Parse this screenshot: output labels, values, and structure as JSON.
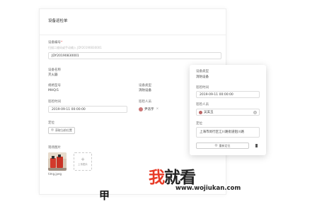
{
  "main": {
    "title": "设备巡检单",
    "device_no_label": "设备编号",
    "device_no_required": "*",
    "device_no_hint": "扫描二维码或手动输入 JDY20190830001",
    "device_no_value": "JDY20190830001",
    "device_name_label": "设备名称",
    "device_name_value": "灭火器",
    "spec_label": "规格型号",
    "spec_value": "MHQ/1",
    "device_type_label": "设备类型",
    "device_type_value": "消防设备",
    "inspect_time_label": "巡检时间",
    "inspect_time_value": "2019-09-11 00:00:00",
    "inspector_label": "巡检人员",
    "inspector_value": "尹浩宇",
    "location_label": "定位",
    "location_button": "获取当前位置",
    "photos_label": "现场图片",
    "photo_filename": "timg.jpeg",
    "upload_label": "上传图片"
  },
  "side": {
    "device_type_label": "设备类型",
    "device_type_value": "消防设备",
    "inspect_time_label": "巡检时间",
    "inspect_time_value": "2019-09-11 00:00:00",
    "inspector_label": "巡检人员",
    "inspector_value": "吴美玉",
    "location_label": "定位",
    "location_value": "上海市闵行区江川路街道铝川路",
    "relocate_button": "重新定位"
  },
  "watermark": {
    "part1": "我",
    "part2": "就看",
    "url": "www.wojiukan.com"
  },
  "fragment": "甲"
}
